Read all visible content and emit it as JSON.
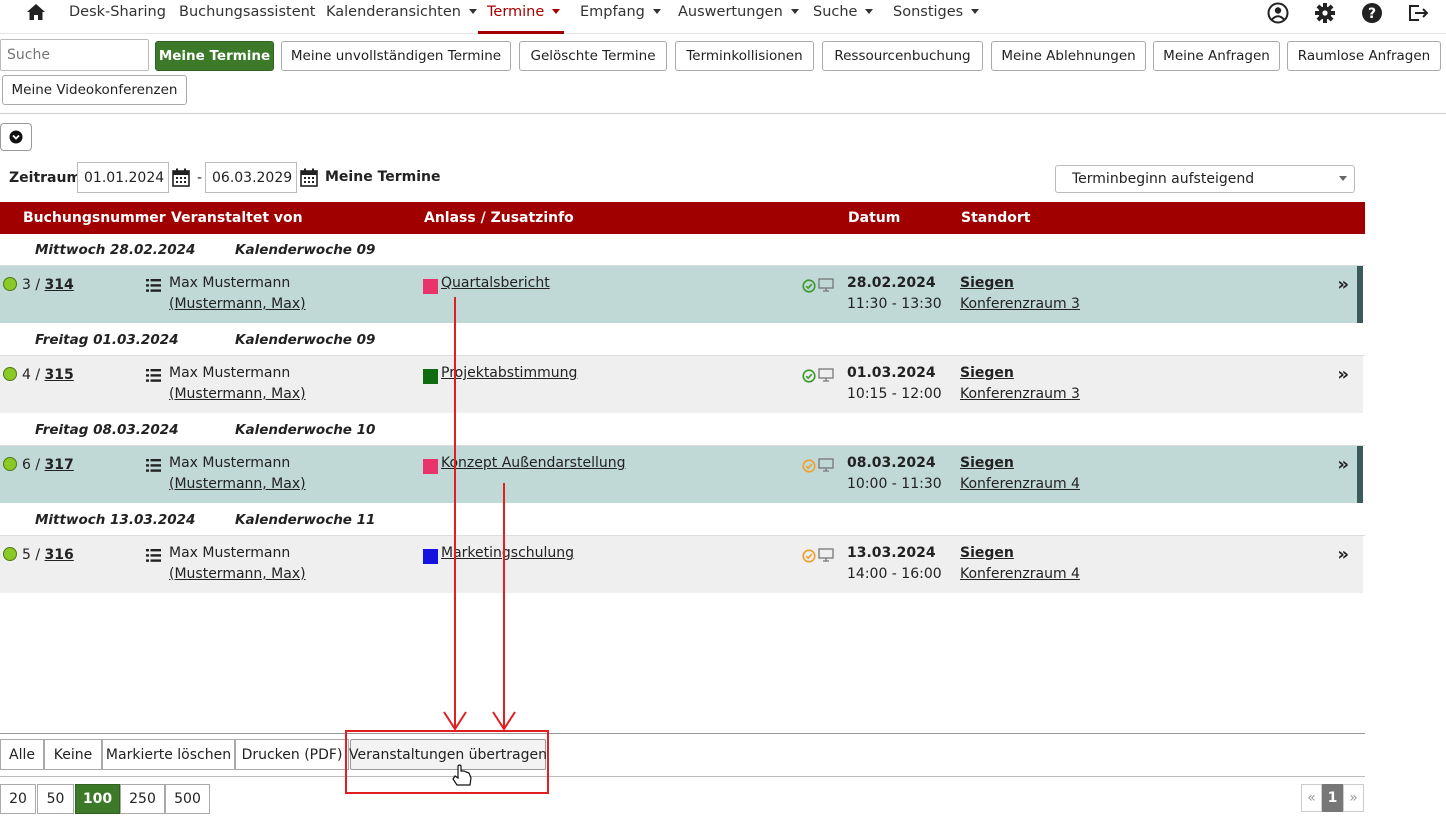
{
  "nav": {
    "items": [
      {
        "label": "Desk-Sharing",
        "caret": false,
        "active": false
      },
      {
        "label": "Buchungsassistent",
        "caret": false,
        "active": false
      },
      {
        "label": "Kalenderansichten",
        "caret": true,
        "active": false
      },
      {
        "label": "Termine",
        "caret": true,
        "active": true
      },
      {
        "label": "Empfang",
        "caret": true,
        "active": false
      },
      {
        "label": "Auswertungen",
        "caret": true,
        "active": false
      },
      {
        "label": "Suche",
        "caret": true,
        "active": false
      },
      {
        "label": "Sonstiges",
        "caret": true,
        "active": false
      }
    ],
    "icons": [
      "home-icon",
      "user-icon",
      "gear-icon",
      "help-icon",
      "logout-icon"
    ]
  },
  "toolbar": {
    "search_placeholder": "Suche",
    "buttons": [
      "Meine Termine",
      "Meine unvollständigen Termine",
      "Gelöschte Termine",
      "Terminkollisionen",
      "Ressourcenbuchung",
      "Meine Ablehnungen",
      "Meine Anfragen",
      "Raumlose Anfragen",
      "Meine Videokonferenzen"
    ]
  },
  "filter": {
    "zeitraum_label": "Zeitraum",
    "date_from": "01.01.2024",
    "date_separator": "-",
    "date_to": "06.03.2029",
    "view_title": "Meine Termine",
    "sort_selected": "Terminbeginn aufsteigend"
  },
  "table": {
    "headers": [
      "Buchungsnummer",
      "Veranstaltet von",
      "Anlass / Zusatzinfo",
      "Datum",
      "Standort"
    ],
    "groups": [
      {
        "day": "Mittwoch 28.02.2024",
        "week": "Kalenderwoche 09"
      },
      {
        "day": "Freitag 01.03.2024",
        "week": "Kalenderwoche 09"
      },
      {
        "day": "Freitag 08.03.2024",
        "week": "Kalenderwoche 10"
      },
      {
        "day": "Mittwoch 13.03.2024",
        "week": "Kalenderwoche 11"
      }
    ],
    "rows": [
      {
        "num_prefix": "3 / ",
        "num_link": "314",
        "organizer": "Max Mustermann",
        "organizer_sub": "(Mustermann, Max)",
        "color": "#e8336b",
        "occasion": "Quartalsbericht",
        "status_color": "#3a9a2a",
        "date": "28.02.2024",
        "time": "11:30 - 13:30",
        "location": "Siegen",
        "room": "Konferenzraum 3",
        "highlight": true
      },
      {
        "num_prefix": "4 / ",
        "num_link": "315",
        "organizer": "Max Mustermann",
        "organizer_sub": "(Mustermann, Max)",
        "color": "#0e6b0e",
        "occasion": "Projektabstimmung",
        "status_color": "#3a9a2a",
        "date": "01.03.2024",
        "time": "10:15 - 12:00",
        "location": "Siegen",
        "room": "Konferenzraum 3",
        "highlight": false
      },
      {
        "num_prefix": "6 / ",
        "num_link": "317",
        "organizer": "Max Mustermann",
        "organizer_sub": "(Mustermann, Max)",
        "color": "#e8336b",
        "occasion": "Konzept Außendarstellung",
        "status_color": "#f0a030",
        "date": "08.03.2024",
        "time": "10:00 - 11:30",
        "location": "Siegen",
        "room": "Konferenzraum 4",
        "highlight": true
      },
      {
        "num_prefix": "5 / ",
        "num_link": "316",
        "organizer": "Max Mustermann",
        "organizer_sub": "(Mustermann, Max)",
        "color": "#1414e0",
        "occasion": "Marketingschulung",
        "status_color": "#f0a030",
        "date": "13.03.2024",
        "time": "14:00 - 16:00",
        "location": "Siegen",
        "room": "Konferenzraum 4",
        "highlight": false
      }
    ],
    "row_action_glyph": "»"
  },
  "actions": [
    "Alle",
    "Keine",
    "Markierte löschen",
    "Drucken (PDF)",
    "Veranstaltungen übertragen"
  ],
  "page_sizes": {
    "options": [
      "20",
      "50",
      "100",
      "250",
      "500"
    ],
    "selected": "100"
  },
  "pagination": {
    "prev": "«",
    "current": "1",
    "next": "»"
  },
  "colors": {
    "brand_red": "#a10000",
    "accent_green": "#3c7a2a",
    "highlight_row": "#c0d8d6",
    "annotation_red": "#e02020"
  }
}
